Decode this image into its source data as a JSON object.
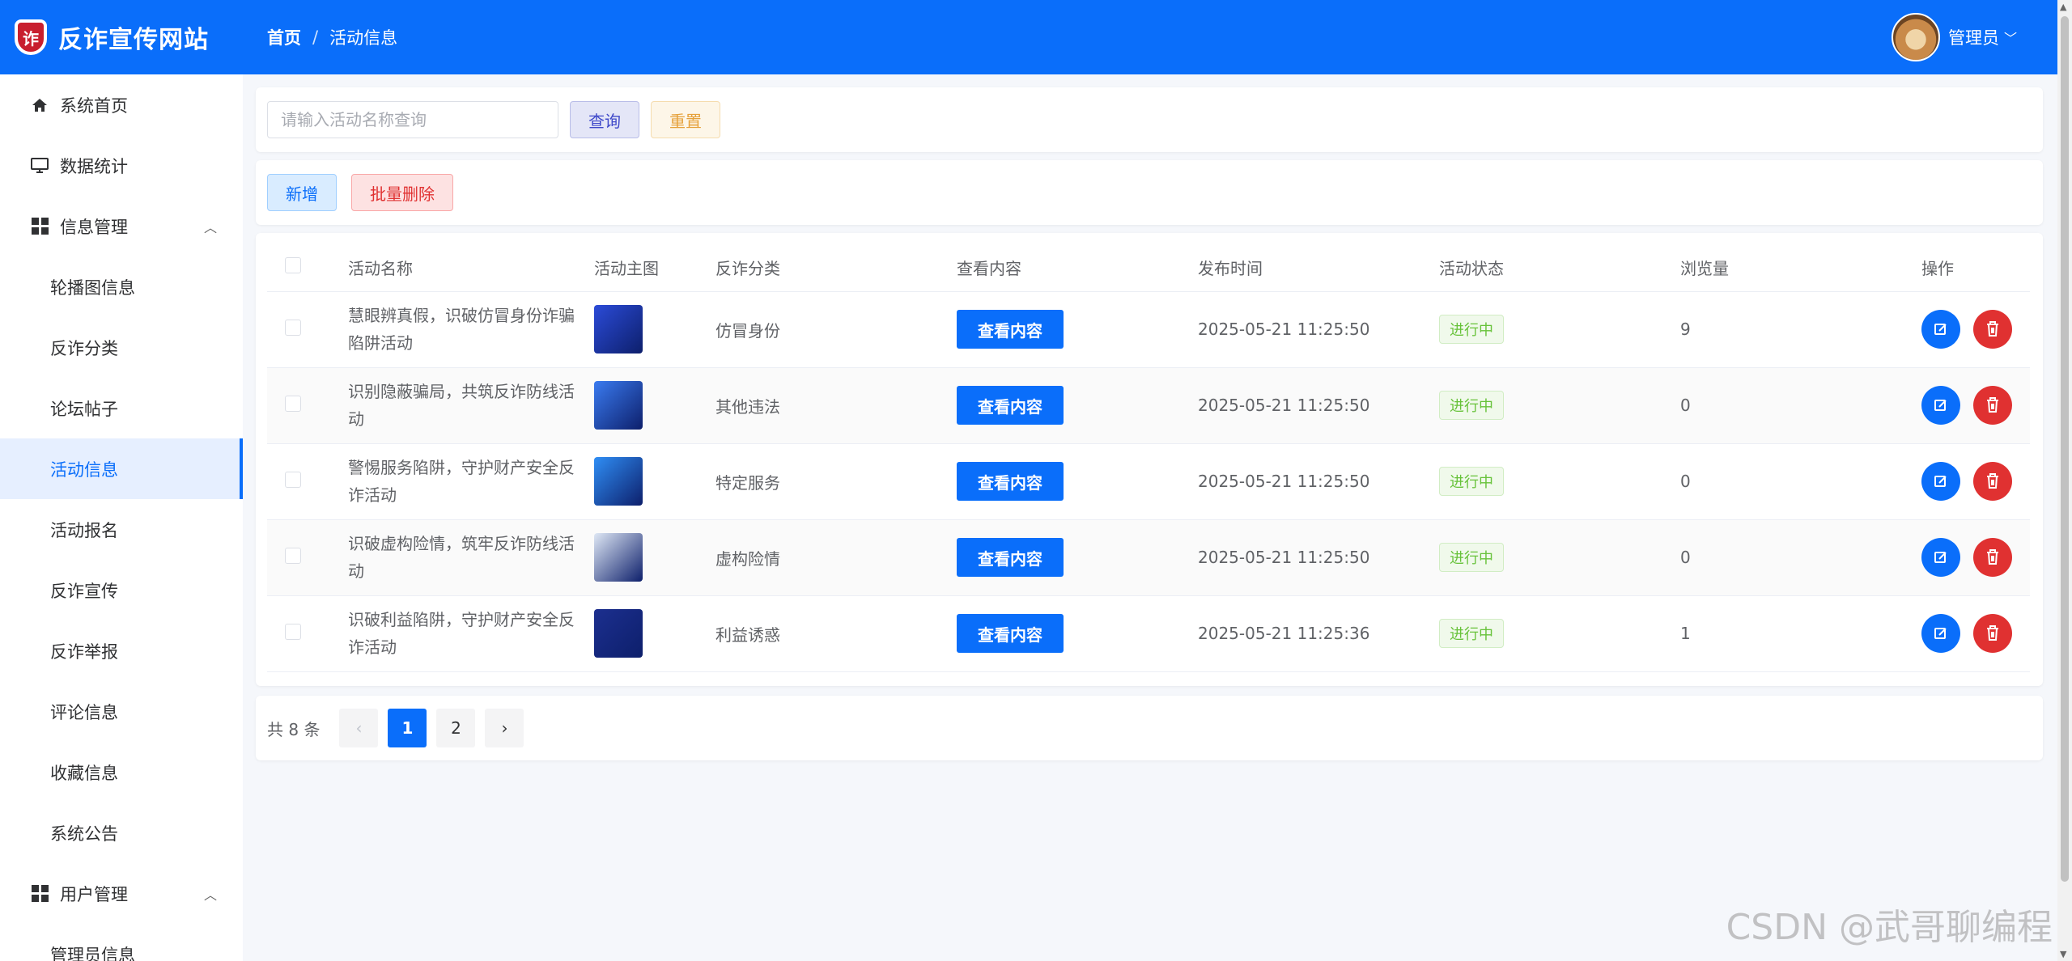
{
  "header": {
    "site_title": "反诈宣传网站",
    "logo_char": "诈",
    "breadcrumb": [
      "首页",
      "活动信息"
    ],
    "user_name": "管理员"
  },
  "sidebar": {
    "items": [
      {
        "label": "系统首页",
        "level": "top",
        "icon": "home-icon"
      },
      {
        "label": "数据统计",
        "level": "top",
        "icon": "monitor-icon"
      },
      {
        "label": "信息管理",
        "level": "top",
        "icon": "grid-icon",
        "expanded": true
      },
      {
        "label": "轮播图信息",
        "level": "sub"
      },
      {
        "label": "反诈分类",
        "level": "sub"
      },
      {
        "label": "论坛帖子",
        "level": "sub"
      },
      {
        "label": "活动信息",
        "level": "sub",
        "active": true
      },
      {
        "label": "活动报名",
        "level": "sub"
      },
      {
        "label": "反诈宣传",
        "level": "sub"
      },
      {
        "label": "反诈举报",
        "level": "sub"
      },
      {
        "label": "评论信息",
        "level": "sub"
      },
      {
        "label": "收藏信息",
        "level": "sub"
      },
      {
        "label": "系统公告",
        "level": "sub"
      },
      {
        "label": "用户管理",
        "level": "top",
        "icon": "grid-icon",
        "expanded": true
      },
      {
        "label": "管理员信息",
        "level": "sub"
      }
    ]
  },
  "search": {
    "placeholder": "请输入活动名称查询",
    "value": "",
    "query_label": "查询",
    "reset_label": "重置"
  },
  "actions": {
    "add_label": "新增",
    "batch_delete_label": "批量删除"
  },
  "table": {
    "columns": [
      "活动名称",
      "活动主图",
      "反诈分类",
      "查看内容",
      "发布时间",
      "活动状态",
      "浏览量",
      "操作"
    ],
    "view_label": "查看内容",
    "rows": [
      {
        "name": "慧眼辨真假，识破仿冒身份诈骗陷阱活动",
        "category": "仿冒身份",
        "time": "2025-05-21 11:25:50",
        "status": "进行中",
        "views": "9",
        "thumb_color": "#2b4bd8"
      },
      {
        "name": "识别隐蔽骗局，共筑反诈防线活动",
        "category": "其他违法",
        "time": "2025-05-21 11:25:50",
        "status": "进行中",
        "views": "0",
        "thumb_color": "#3a7bf0"
      },
      {
        "name": "警惕服务陷阱，守护财产安全反诈活动",
        "category": "特定服务",
        "time": "2025-05-21 11:25:50",
        "status": "进行中",
        "views": "0",
        "thumb_color": "#2f8ef5"
      },
      {
        "name": "识破虚构险情，筑牢反诈防线活动",
        "category": "虚构险情",
        "time": "2025-05-21 11:25:50",
        "status": "进行中",
        "views": "0",
        "thumb_color": "#dfe8f5"
      },
      {
        "name": "识破利益陷阱，守护财产安全反诈活动",
        "category": "利益诱惑",
        "time": "2025-05-21 11:25:36",
        "status": "进行中",
        "views": "1",
        "thumb_color": "#1c2f8f"
      }
    ]
  },
  "pagination": {
    "total_text": "共 8 条",
    "pages": [
      "1",
      "2"
    ],
    "current": "1"
  },
  "watermark": "CSDN @武哥聊编程",
  "colors": {
    "primary": "#0a6efa",
    "danger": "#e03131",
    "success": "#67c23a",
    "warning": "#e6a23c"
  }
}
